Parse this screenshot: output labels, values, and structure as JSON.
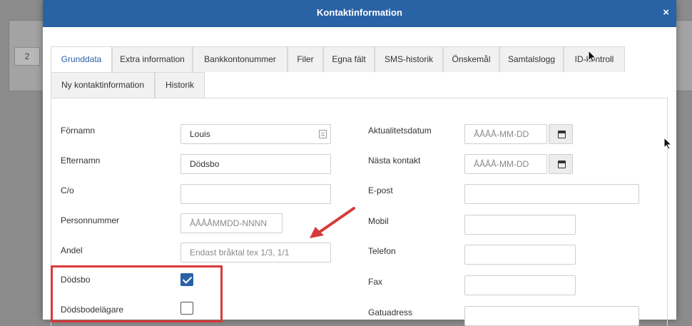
{
  "background": {
    "row_number": "2"
  },
  "modal": {
    "title": "Kontaktinformation",
    "close_label": "×"
  },
  "tabs": [
    {
      "label": "Grunddata",
      "active": true
    },
    {
      "label": "Extra information"
    },
    {
      "label": "Bankkontonummer"
    },
    {
      "label": "Filer"
    },
    {
      "label": "Egna fält"
    },
    {
      "label": "SMS-historik"
    },
    {
      "label": "Önskemål"
    },
    {
      "label": "Samtalslogg"
    },
    {
      "label": "ID-kontroll"
    },
    {
      "label": "Ny kontaktinformation"
    },
    {
      "label": "Historik"
    }
  ],
  "form_left": {
    "fornamn": {
      "label": "Förnamn",
      "value": "Louis"
    },
    "efternamn": {
      "label": "Efternamn",
      "value": "Dödsbo"
    },
    "co": {
      "label": "C/o",
      "value": ""
    },
    "personnummer": {
      "label": "Personnummer",
      "placeholder": "ÅÅÅÅMMDD-NNNN"
    },
    "andel": {
      "label": "Andel",
      "placeholder": "Endast bråktal tex 1/3, 1/1"
    },
    "dodsbo": {
      "label": "Dödsbo",
      "checked": true
    },
    "dodsbodelagare": {
      "label": "Dödsbodelägare",
      "checked": false
    }
  },
  "form_right": {
    "aktualitetsdatum": {
      "label": "Aktualitetsdatum",
      "placeholder": "ÅÅÅÅ-MM-DD"
    },
    "nasta_kontakt": {
      "label": "Nästa kontakt",
      "placeholder": "ÅÅÅÅ-MM-DD"
    },
    "epost": {
      "label": "E-post",
      "value": ""
    },
    "mobil": {
      "label": "Mobil",
      "value": ""
    },
    "telefon": {
      "label": "Telefon",
      "value": ""
    },
    "fax": {
      "label": "Fax",
      "value": ""
    },
    "gatuadress": {
      "label": "Gatuadress",
      "value": ""
    }
  },
  "colors": {
    "header": "#2a62a6",
    "annotation": "#d73a3a"
  }
}
